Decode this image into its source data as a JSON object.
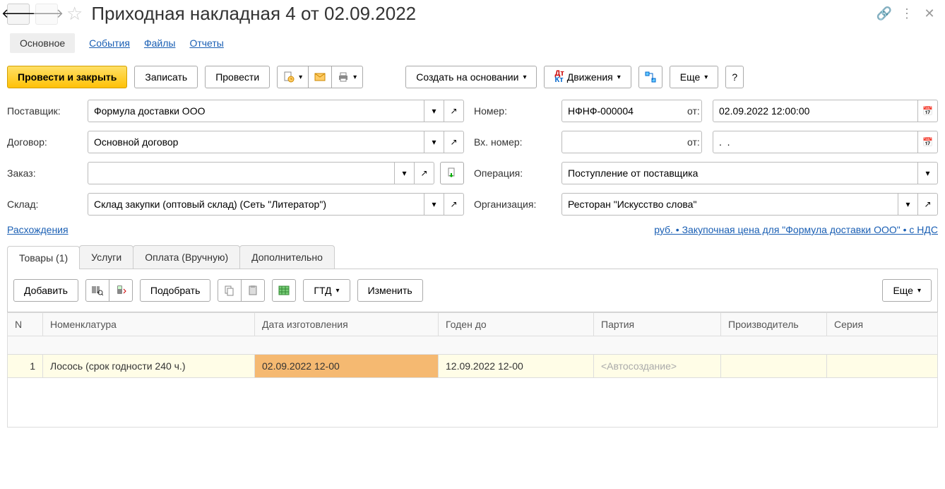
{
  "header": {
    "title": "Приходная накладная 4 от 02.09.2022"
  },
  "nav_tabs": {
    "main": "Основное",
    "events": "События",
    "files": "Файлы",
    "reports": "Отчеты"
  },
  "toolbar": {
    "post_close": "Провести и закрыть",
    "save": "Записать",
    "post": "Провести",
    "create_based": "Создать на основании",
    "movements": "Движения",
    "more": "Еще",
    "help": "?"
  },
  "form": {
    "supplier_label": "Поставщик:",
    "supplier_value": "Формула доставки ООО",
    "number_label": "Номер:",
    "number_value": "НФНФ-000004",
    "date_from_label": "от:",
    "date_value": "02.09.2022 12:00:00",
    "contract_label": "Договор:",
    "contract_value": "Основной договор",
    "incoming_label": "Вх. номер:",
    "incoming_value": "",
    "incoming_date_label": "от:",
    "incoming_date_value": ".  .",
    "order_label": "Заказ:",
    "order_value": "",
    "operation_label": "Операция:",
    "operation_value": "Поступление от поставщика",
    "warehouse_label": "Склад:",
    "warehouse_value": "Склад закупки (оптовый склад) (Сеть \"Литератор\")",
    "org_label": "Организация:",
    "org_value": "Ресторан \"Искусство слова\""
  },
  "links": {
    "discrepancies": "Расхождения",
    "price_info": "руб. • Закупочная цена для \"Формула доставки ООО\" • с НДС"
  },
  "subtabs": {
    "goods": "Товары (1)",
    "services": "Услуги",
    "payment": "Оплата (Вручную)",
    "additional": "Дополнительно"
  },
  "sub_toolbar": {
    "add": "Добавить",
    "select": "Подобрать",
    "gtd": "ГТД",
    "change": "Изменить",
    "more": "Еще"
  },
  "table": {
    "headers": {
      "n": "N",
      "nomenclature": "Номенклатура",
      "mfg_date": "Дата изготовления",
      "expiry": "Годен до",
      "batch": "Партия",
      "manufacturer": "Производитель",
      "series": "Серия"
    },
    "rows": [
      {
        "n": "1",
        "nomenclature": "Лосось (срок годности 240 ч.)",
        "mfg_date": "02.09.2022 12-00",
        "expiry": "12.09.2022 12-00",
        "batch": "<Автосоздание>",
        "manufacturer": "",
        "series": ""
      }
    ]
  }
}
